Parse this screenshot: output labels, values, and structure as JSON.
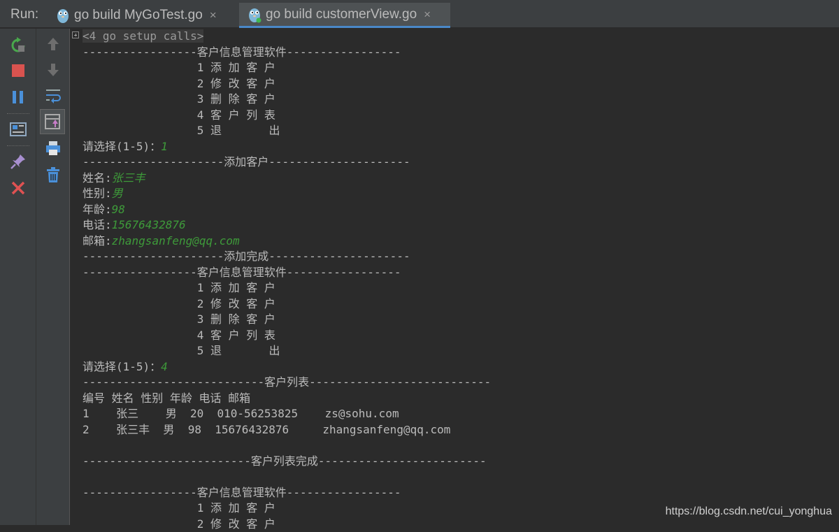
{
  "toolbar": {
    "run_label": "Run:"
  },
  "tabs": [
    {
      "title": "go build MyGoTest.go",
      "close": "×"
    },
    {
      "title": "go build customerView.go",
      "close": "×"
    }
  ],
  "console": {
    "lines": [
      [
        {
          "t": "<4 go setup calls>"
        }
      ],
      [
        {
          "t": "-----------------客户信息管理软件-----------------"
        }
      ],
      [
        {
          "t": "                 1 添 加 客 户"
        }
      ],
      [
        {
          "t": "                 2 修 改 客 户"
        }
      ],
      [
        {
          "t": "                 3 删 除 客 户"
        }
      ],
      [
        {
          "t": "                 4 客 户 列 表"
        }
      ],
      [
        {
          "t": "                 5 退       出"
        }
      ],
      [
        {
          "t": "请选择(1-5)："
        },
        {
          "t": "1",
          "in": true
        }
      ],
      [
        {
          "t": "---------------------添加客户---------------------"
        }
      ],
      [
        {
          "t": "姓名:"
        },
        {
          "t": "张三丰",
          "in": true
        }
      ],
      [
        {
          "t": "性别:"
        },
        {
          "t": "男",
          "in": true
        }
      ],
      [
        {
          "t": "年龄:"
        },
        {
          "t": "98",
          "in": true
        }
      ],
      [
        {
          "t": "电话:"
        },
        {
          "t": "15676432876",
          "in": true
        }
      ],
      [
        {
          "t": "邮箱:"
        },
        {
          "t": "zhangsanfeng@qq.com",
          "in": true
        }
      ],
      [
        {
          "t": "---------------------添加完成---------------------"
        }
      ],
      [
        {
          "t": "-----------------客户信息管理软件-----------------"
        }
      ],
      [
        {
          "t": "                 1 添 加 客 户"
        }
      ],
      [
        {
          "t": "                 2 修 改 客 户"
        }
      ],
      [
        {
          "t": "                 3 删 除 客 户"
        }
      ],
      [
        {
          "t": "                 4 客 户 列 表"
        }
      ],
      [
        {
          "t": "                 5 退       出"
        }
      ],
      [
        {
          "t": "请选择(1-5)："
        },
        {
          "t": "4",
          "in": true
        }
      ],
      [
        {
          "t": "---------------------------客户列表---------------------------"
        }
      ],
      [
        {
          "t": "编号 姓名 性别 年龄 电话 邮箱"
        }
      ],
      [
        {
          "t": "1    张三    男  20  010-56253825    zs@sohu.com"
        }
      ],
      [
        {
          "t": "2    张三丰  男  98  15676432876     zhangsanfeng@qq.com"
        }
      ],
      [
        {
          "t": ""
        }
      ],
      [
        {
          "t": "-------------------------客户列表完成-------------------------"
        }
      ],
      [
        {
          "t": ""
        }
      ],
      [
        {
          "t": "-----------------客户信息管理软件-----------------"
        }
      ],
      [
        {
          "t": "                 1 添 加 客 户"
        }
      ],
      [
        {
          "t": "                 2 修 改 客 户"
        }
      ]
    ]
  },
  "watermark": "https://blog.csdn.net/cui_yonghua"
}
